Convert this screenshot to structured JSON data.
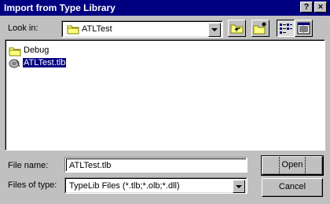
{
  "window": {
    "title": "Import from Type Library",
    "help_button": "?",
    "close_button": "×"
  },
  "look_in": {
    "label": "Look in:",
    "value": "ATLTest"
  },
  "toolbar": {
    "icons": [
      "up-one-level-icon",
      "create-new-folder-icon",
      "list-view-icon",
      "details-view-icon"
    ]
  },
  "files": [
    {
      "name": "Debug",
      "type": "folder",
      "selected": false
    },
    {
      "name": "ATLTest.tlb",
      "type": "typelib",
      "selected": true
    }
  ],
  "file_name": {
    "label": "File name:",
    "value": "ATLTest.tlb"
  },
  "files_of_type": {
    "label": "Files of type:",
    "value": "TypeLib Files (*.tlb;*.olb;*.dll)"
  },
  "buttons": {
    "open": "Open",
    "cancel": "Cancel"
  },
  "colors": {
    "title_bar": "#000080",
    "face": "#c0c0c0",
    "selection": "#000080"
  }
}
